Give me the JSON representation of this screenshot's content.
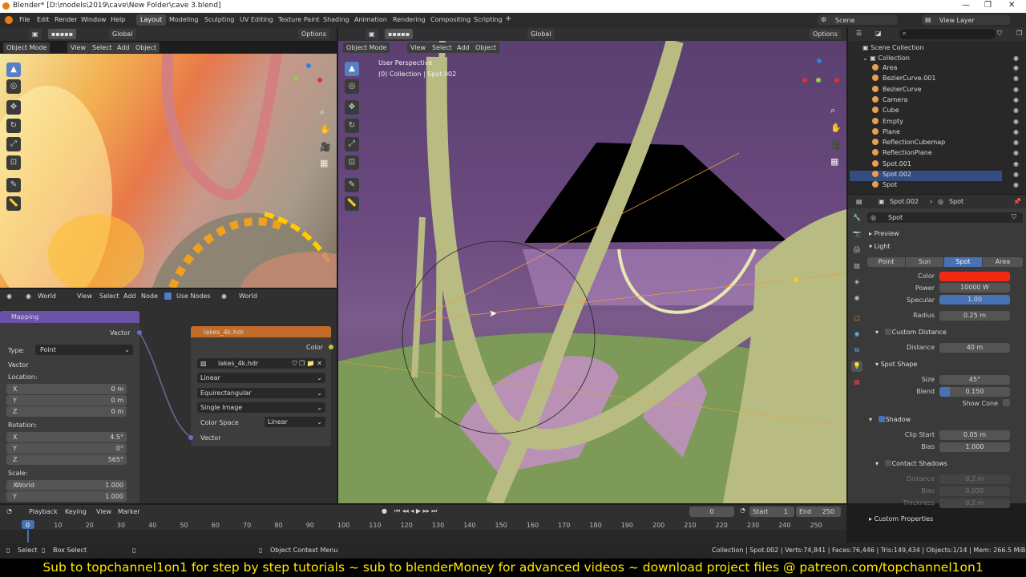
{
  "window": {
    "title": "Blender* [D:\\models\\2019\\cave\\New Folder\\cave 3.blend]"
  },
  "menu": [
    "File",
    "Edit",
    "Render",
    "Window",
    "Help"
  ],
  "workspaces": [
    "Layout",
    "Modeling",
    "Sculpting",
    "UV Editing",
    "Texture Paint",
    "Shading",
    "Animation",
    "Rendering",
    "Compositing",
    "Scripting"
  ],
  "scene": "Scene",
  "view_layer": "View Layer",
  "left_view": {
    "mode": "Object Mode",
    "menus": [
      "View",
      "Select",
      "Add",
      "Object"
    ],
    "orientation": "Global",
    "options": "Options"
  },
  "main_view": {
    "mode": "Object Mode",
    "menus": [
      "View",
      "Select",
      "Add",
      "Object"
    ],
    "orientation": "Global",
    "options": "Options",
    "perspective": "User Perspective",
    "collection_line": "(0) Collection | Spot.002"
  },
  "node_editor": {
    "type": "World",
    "menus": [
      "View",
      "Select",
      "Add",
      "Node"
    ],
    "use_nodes": "Use Nodes",
    "world": "World",
    "mapping": {
      "title": "Mapping",
      "vector_out": "Vector",
      "type_label": "Type:",
      "type_value": "Point",
      "vector_label": "Vector",
      "location": "Location:",
      "rotation": "Rotation:",
      "scale": "Scale:",
      "loc": [
        {
          "a": "X",
          "v": "0 m"
        },
        {
          "a": "Y",
          "v": "0 m"
        },
        {
          "a": "Z",
          "v": "0 m"
        }
      ],
      "rot": [
        {
          "a": "X",
          "v": "4.5°"
        },
        {
          "a": "Y",
          "v": "0°"
        },
        {
          "a": "Z",
          "v": "565°"
        }
      ],
      "scl": [
        {
          "a": "X",
          "v": "1.000"
        },
        {
          "a": "Y",
          "v": "1.000"
        }
      ],
      "world_overlay": "World"
    },
    "image": {
      "title": "lakes_4k.hdr",
      "color_out": "Color",
      "file": "lakes_4k.hdr",
      "interp": "Linear",
      "proj": "Equirectangular",
      "source": "Single Image",
      "cs_label": "Color Space",
      "cs_value": "Linear",
      "vector_in": "Vector"
    }
  },
  "outliner": {
    "search": "",
    "root": "Scene Collection",
    "collection": "Collection",
    "items": [
      {
        "name": "Area",
        "color": "#e8a050"
      },
      {
        "name": "BezierCurve.001",
        "color": "#e8a050"
      },
      {
        "name": "BezierCurve",
        "color": "#e8a050"
      },
      {
        "name": "Camera",
        "color": "#e8a050"
      },
      {
        "name": "Cube",
        "color": "#e8a050"
      },
      {
        "name": "Empty",
        "color": "#e8a050"
      },
      {
        "name": "Plane",
        "color": "#e8a050"
      },
      {
        "name": "ReflectionCubemap",
        "color": "#e8a050"
      },
      {
        "name": "ReflectionPlane",
        "color": "#e8a050"
      },
      {
        "name": "Spot.001",
        "color": "#e8a050"
      },
      {
        "name": "Spot.002",
        "color": "#e8a050"
      },
      {
        "name": "Spot",
        "color": "#e8a050"
      }
    ]
  },
  "properties": {
    "object": "Spot.002",
    "data": "Spot",
    "data_field": "Spot",
    "preview": "Preview",
    "light": "Light",
    "light_types": [
      "Point",
      "Sun",
      "Spot",
      "Area"
    ],
    "color_label": "Color",
    "color_value": "#f02a10",
    "power_label": "Power",
    "power": "10000 W",
    "specular_label": "Specular",
    "specular": "1.00",
    "radius_label": "Radius",
    "radius": "0.25 m",
    "custom_distance": "Custom Distance",
    "distance_label": "Distance",
    "distance": "40 m",
    "spot_shape": "Spot Shape",
    "size_label": "Size",
    "size": "45°",
    "blend_label": "Blend",
    "blend": "0.150",
    "show_cone": "Show Cone",
    "shadow": "Shadow",
    "clip_label": "Clip Start",
    "clip": "0.05 m",
    "bias_label": "Bias",
    "bias": "1.000",
    "contact": "Contact Shadows",
    "c_dist_label": "Distance",
    "c_dist": "0.2 m",
    "c_bias_label": "Bias",
    "c_bias": "0.030",
    "c_thick_label": "Thickness",
    "c_thick": "0.2 m",
    "custom_props": "Custom Properties"
  },
  "timeline": {
    "menus": [
      "Playback",
      "Keying",
      "View",
      "Marker"
    ],
    "frame": "0",
    "start_label": "Start",
    "start": "1",
    "end_label": "End",
    "end": "250",
    "ticks": [
      "0",
      "10",
      "20",
      "30",
      "40",
      "50",
      "60",
      "70",
      "80",
      "90",
      "100",
      "110",
      "120",
      "130",
      "140",
      "150",
      "160",
      "170",
      "180",
      "190",
      "200",
      "210",
      "220",
      "230",
      "240",
      "250"
    ]
  },
  "status": {
    "select": "Select",
    "box": "Box Select",
    "ctx": "Object Context Menu",
    "stats": "Collection | Spot.002 | Verts:74,841 | Faces:76,446 | Tris:149,434 | Objects:1/14 | Mem: 266.5 MiB | v2.81.16"
  },
  "caption": "Sub to topchannel1on1 for step by step tutorials ~ sub to blenderMoney for advanced videos ~ download project files @ patreon.com/topchannel1on1"
}
